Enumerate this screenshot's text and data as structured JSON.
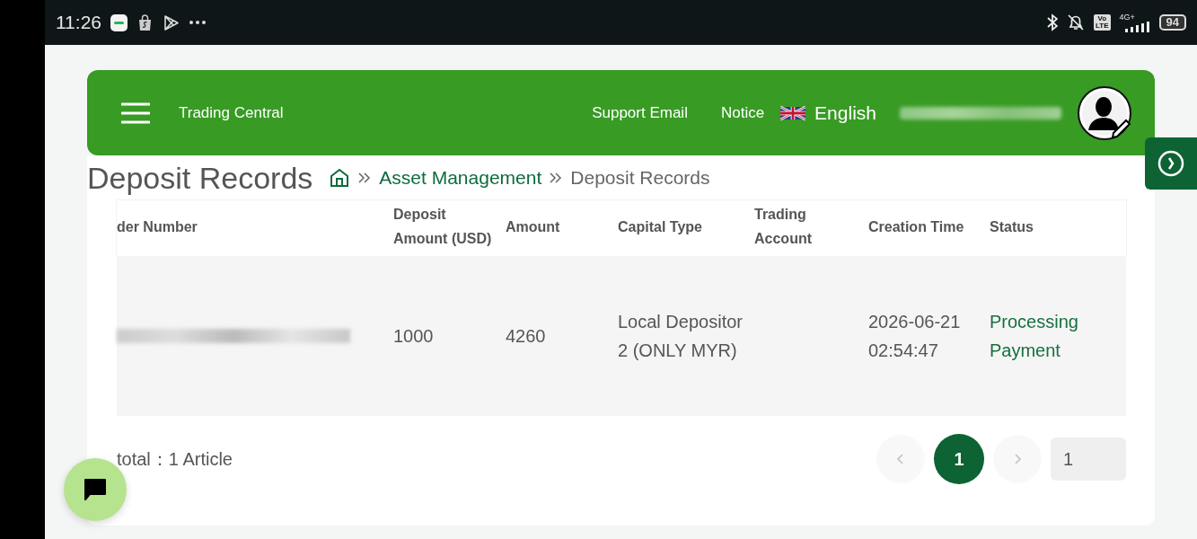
{
  "status_bar": {
    "time": "11:26",
    "volte": [
      "Vo",
      "LTE"
    ],
    "network": "4G+",
    "battery": "94"
  },
  "header": {
    "brand": "Trading Central",
    "links": [
      "Support Email",
      "Notice"
    ],
    "language": "English",
    "username_redacted": true
  },
  "page": {
    "title": "Deposit Records",
    "breadcrumb": [
      {
        "label": "Asset Management",
        "kind": "link"
      },
      {
        "label": "Deposit Records",
        "kind": "current"
      }
    ]
  },
  "table": {
    "columns": [
      "der Number",
      "Deposit Amount (USD)",
      "Amount",
      "Capital Type",
      "Trading Account",
      "Creation Time",
      "Status"
    ],
    "rows": [
      {
        "cells": [
          {
            "kind": "redacted"
          },
          {
            "kind": "text",
            "text": "1000"
          },
          {
            "kind": "text",
            "text": "4260"
          },
          {
            "kind": "text",
            "text": "Local Depositor 2 (ONLY MYR)"
          },
          {
            "kind": "empty"
          },
          {
            "kind": "text",
            "text": "2026-06-21 02:54:47"
          },
          {
            "kind": "status",
            "text": "Processing Payment"
          }
        ]
      }
    ]
  },
  "footer": {
    "total": "total：1 Article",
    "pages": [
      {
        "label": "1",
        "selected": true
      }
    ],
    "prev_disabled": true,
    "next_disabled": true,
    "jump_value": "1"
  }
}
